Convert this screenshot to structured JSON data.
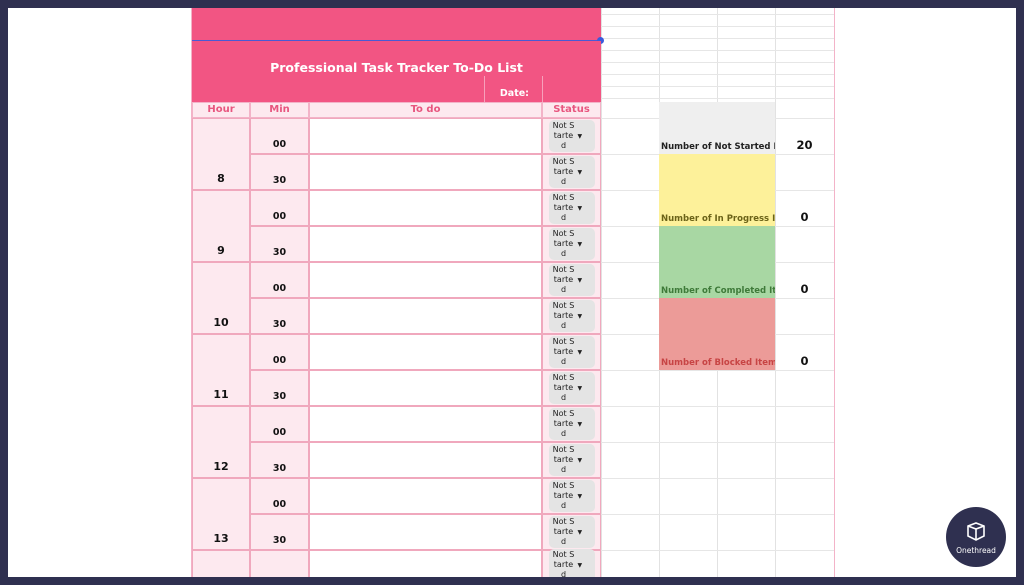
{
  "banner": {
    "title": "Professional Task Tracker To-Do List",
    "date_label": "Date:"
  },
  "columns": {
    "hour": "Hour",
    "min": "Min",
    "todo": "To do",
    "status": "Status"
  },
  "rows": [
    {
      "hour": "8",
      "min": "00",
      "status": "Not Started"
    },
    {
      "hour": "",
      "min": "30",
      "status": "Not Started"
    },
    {
      "hour": "9",
      "min": "00",
      "status": "Not Started"
    },
    {
      "hour": "",
      "min": "30",
      "status": "Not Started"
    },
    {
      "hour": "10",
      "min": "00",
      "status": "Not Started"
    },
    {
      "hour": "",
      "min": "30",
      "status": "Not Started"
    },
    {
      "hour": "11",
      "min": "00",
      "status": "Not Started"
    },
    {
      "hour": "",
      "min": "30",
      "status": "Not Started"
    },
    {
      "hour": "12",
      "min": "00",
      "status": "Not Started"
    },
    {
      "hour": "",
      "min": "30",
      "status": "Not Started"
    },
    {
      "hour": "13",
      "min": "00",
      "status": "Not Started"
    },
    {
      "hour": "",
      "min": "30",
      "status": "Not Started"
    },
    {
      "hour": "",
      "min": "",
      "status": "Not Started"
    }
  ],
  "summary": [
    {
      "label": "Number of Not Started Ite",
      "count": "20",
      "bg": "#efefef",
      "fg": "#222222"
    },
    {
      "label": "Number of In Progress Ite",
      "count": "0",
      "bg": "#fdf19a",
      "fg": "#6b6318"
    },
    {
      "label": "Number of Completed Ite",
      "count": "0",
      "bg": "#a8d7a3",
      "fg": "#3e7a39"
    },
    {
      "label": "Number of Blocked Items",
      "count": "0",
      "bg": "#ec9b98",
      "fg": "#c74444"
    }
  ],
  "watermark": {
    "text": "Onethread",
    "icon": "onethread-logo-icon"
  },
  "colors": {
    "banner": "#f25583",
    "header_text": "#e8567f",
    "cell_pink": "#fde9ef",
    "border": "#f0a8bd"
  }
}
